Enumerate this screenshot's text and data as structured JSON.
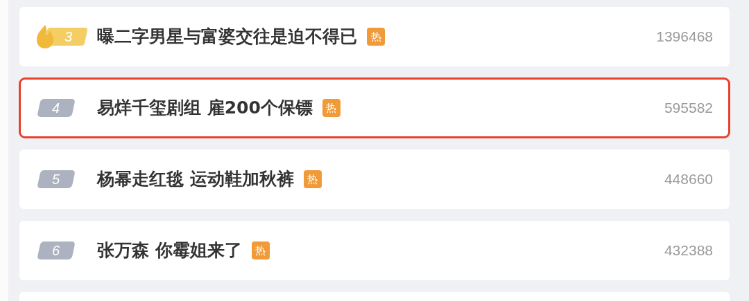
{
  "items": [
    {
      "rank": "3",
      "kind": "top",
      "title": "曝二字男星与富婆交往是迫不得已",
      "tag": "热",
      "count": "1396468",
      "highlighted": false
    },
    {
      "rank": "4",
      "kind": "normal",
      "title": "易烊千玺剧组 雇200个保镖",
      "tag": "热",
      "count": "595582",
      "highlighted": true
    },
    {
      "rank": "5",
      "kind": "normal",
      "title": "杨幂走红毯 运动鞋加秋裤",
      "tag": "热",
      "count": "448660",
      "highlighted": false
    },
    {
      "rank": "6",
      "kind": "normal",
      "title": "张万森 你霉姐来了",
      "tag": "热",
      "count": "432388",
      "highlighted": false
    }
  ]
}
